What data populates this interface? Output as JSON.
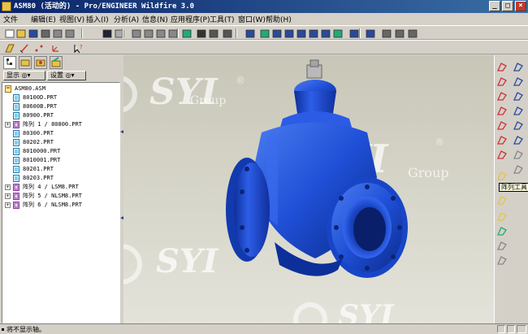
{
  "window": {
    "title": "ASM80 (活动的) - Pro/ENGINEER Wildfire 3.0",
    "buttons": [
      "_",
      "□",
      "×"
    ]
  },
  "menu": [
    "文件",
    "编辑(E)",
    "视图(V)",
    "插入(I)",
    "分析(A)",
    "信息(N)",
    "应用程序(P)",
    "工具(T)",
    "窗口(W)",
    "帮助(H)"
  ],
  "panel": {
    "show_label": "显示",
    "settings_label": "设置"
  },
  "tree": {
    "items": [
      {
        "label": "ASM80.ASM",
        "type": "asm",
        "depth": 0,
        "expandable": false
      },
      {
        "label": "80100D.PRT",
        "type": "prt",
        "depth": 1,
        "expandable": false
      },
      {
        "label": "80600B.PRT",
        "type": "prt",
        "depth": 1,
        "expandable": false
      },
      {
        "label": "80900.PRT",
        "type": "prt",
        "depth": 1,
        "expandable": false
      },
      {
        "label": "阵列 1 / 80800.PRT",
        "type": "pattern",
        "depth": 1,
        "expandable": true
      },
      {
        "label": "80300.PRT",
        "type": "prt",
        "depth": 1,
        "expandable": false
      },
      {
        "label": "80202.PRT",
        "type": "prt",
        "depth": 1,
        "expandable": false
      },
      {
        "label": "8010000.PRT",
        "type": "prt",
        "depth": 1,
        "expandable": false
      },
      {
        "label": "8010001.PRT",
        "type": "prt",
        "depth": 1,
        "expandable": false
      },
      {
        "label": "80201.PRT",
        "type": "prt",
        "depth": 1,
        "expandable": false
      },
      {
        "label": "80203.PRT",
        "type": "prt",
        "depth": 1,
        "expandable": false
      },
      {
        "label": "阵列 4 / LSM8.PRT",
        "type": "pattern",
        "depth": 1,
        "expandable": true
      },
      {
        "label": "阵列 5 / NLSM8.PRT",
        "type": "pattern",
        "depth": 1,
        "expandable": true
      },
      {
        "label": "阵列 6 / NLSM8.PRT",
        "type": "pattern",
        "depth": 1,
        "expandable": true
      }
    ]
  },
  "viewport": {
    "watermark_text": "SYI",
    "watermark_sub": "Group",
    "reg_mark": "®",
    "model_color": "#1f4fd6"
  },
  "tooltip": "阵列工具",
  "status": {
    "message": "将不显示轴。"
  },
  "icons": {
    "toolbar1": [
      "new-icon",
      "open-icon",
      "save-icon",
      "print-icon",
      "email-icon",
      "email-link-icon",
      "undo-icon",
      "redo-icon",
      "cut-icon",
      "copy-icon",
      "paste-icon",
      "paste-special-icon",
      "regenerate-icon",
      "find-icon",
      "select-box-icon",
      "repaint-icon",
      "spin-center-icon",
      "orient-icon",
      "zoom-in-icon",
      "zoom-out-icon",
      "refit-icon",
      "reorient-icon",
      "saved-views-icon",
      "layers-icon",
      "view-manager-icon",
      "shading-icon",
      "hidden-line-icon",
      "no-hidden-icon",
      "wireframe-icon"
    ],
    "toolbar2": [
      "datum-plane-display-icon",
      "datum-axis-display-icon",
      "datum-point-display-icon",
      "csys-display-icon",
      "context-help-icon"
    ]
  }
}
